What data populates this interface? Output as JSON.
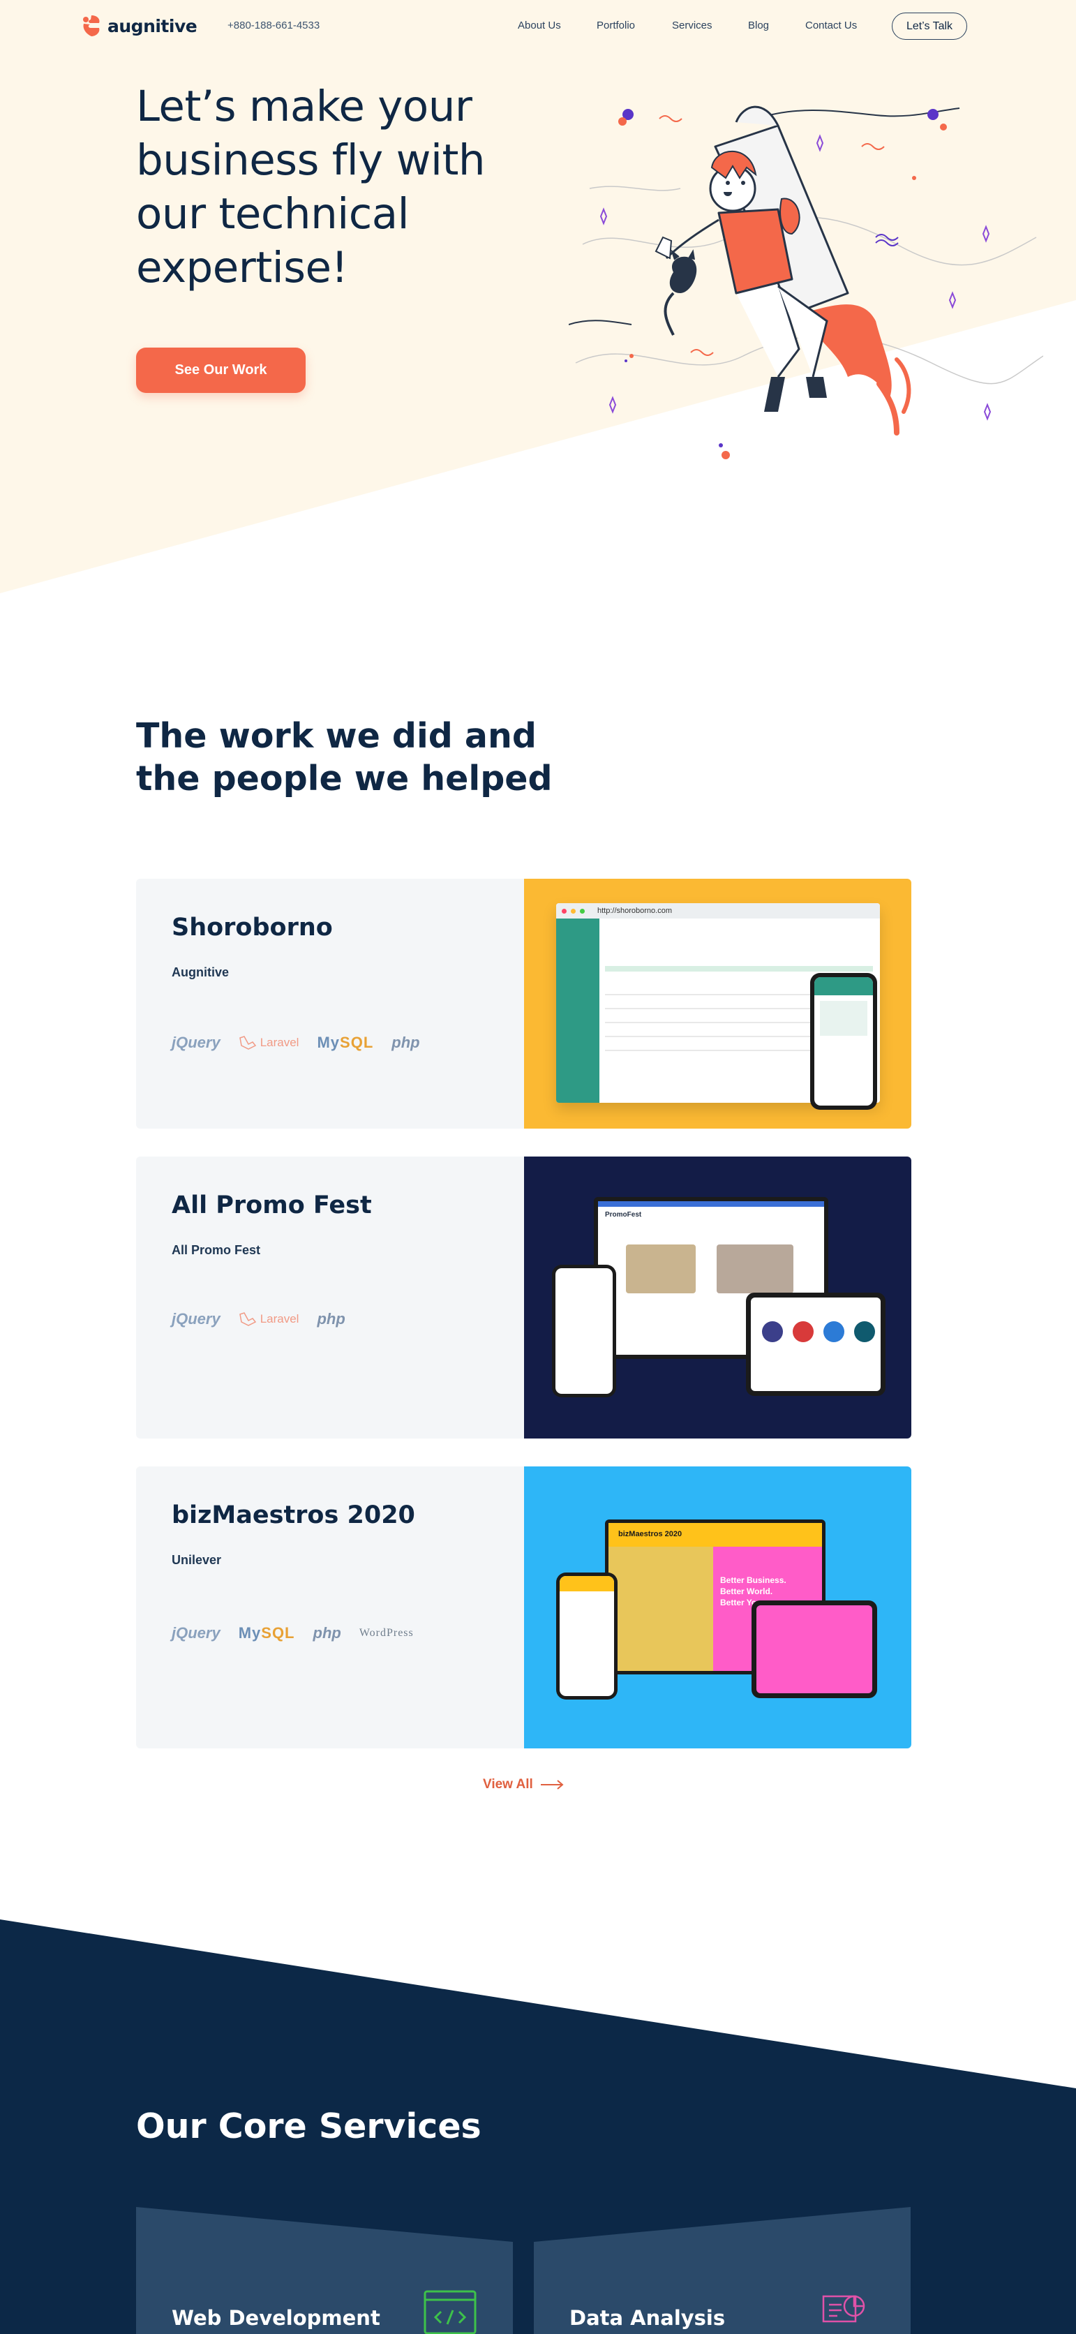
{
  "brand": {
    "name": "augnitive",
    "phone": "+880-188-661-4533",
    "accent": "#f4684a",
    "navy": "#0f2744"
  },
  "nav": {
    "items": [
      {
        "label": "About Us"
      },
      {
        "label": "Portfolio"
      },
      {
        "label": "Services"
      },
      {
        "label": "Blog"
      },
      {
        "label": "Contact Us"
      }
    ],
    "cta_label": "Let’s Talk"
  },
  "hero": {
    "lines": [
      "Let’s make your",
      "business fly with",
      "our technical",
      "expertise!"
    ],
    "button_label": "See Our Work",
    "illustration": "rocket-man-with-cat-illustration"
  },
  "work": {
    "title_lines": [
      "The work we did and",
      "the people we helped"
    ],
    "projects": [
      {
        "name": "Shoroborno",
        "client": "Augnitive",
        "techs": [
          "jQuery",
          "Laravel",
          "MySQL",
          "php"
        ],
        "bg": "#fbb933",
        "screen_url": "http://shoroborno.com"
      },
      {
        "name": "All Promo Fest",
        "client": "All Promo Fest",
        "techs": [
          "jQuery",
          "Laravel",
          "php"
        ],
        "bg": "#131c47",
        "screen_brand": "PromoFest"
      },
      {
        "name": "bizMaestros 2020",
        "client": "Unilever",
        "techs": [
          "jQuery",
          "MySQL",
          "php",
          "WordPress"
        ],
        "bg": "#2eb6f7",
        "screen_brand": "bizMaestros 2020",
        "screen_tagline": [
          "Better Business.",
          "Better World.",
          "Better You."
        ]
      }
    ],
    "view_all_label": "View All"
  },
  "services": {
    "title": "Our Core Services",
    "items": [
      {
        "name": "Web Development",
        "icon": "code-window-icon",
        "icon_color": "#3ec24a"
      },
      {
        "name": "Data Analysis",
        "icon": "data-analysis-icon",
        "icon_color": "#e052a8"
      }
    ]
  }
}
